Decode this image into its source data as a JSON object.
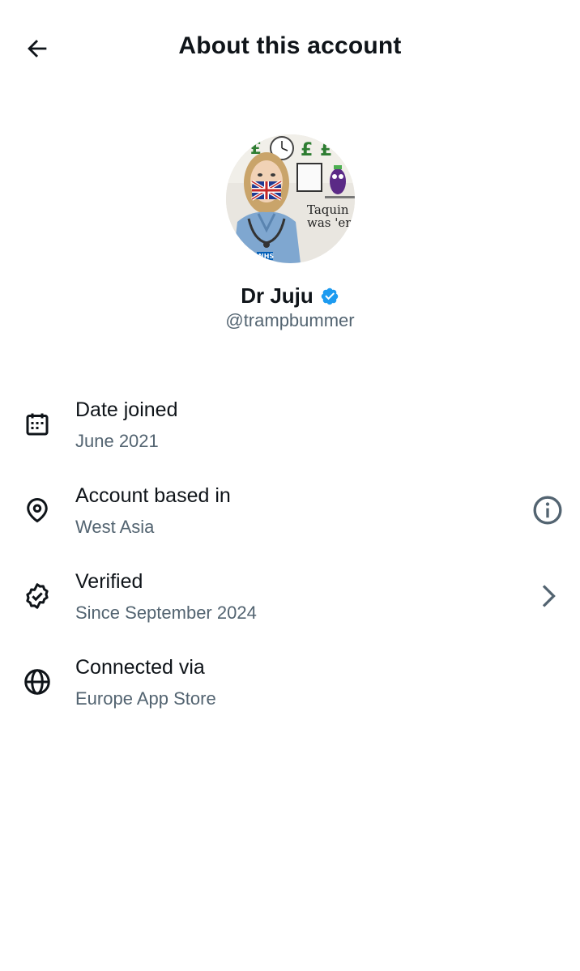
{
  "header": {
    "title": "About this account",
    "back_icon": "arrow-left-icon"
  },
  "profile": {
    "name": "Dr Juju",
    "handle": "@trampbummer",
    "verified": true,
    "badge_color": "#1d9bf0",
    "avatar_text_lines": [
      "Taquin",
      "was 'ere"
    ]
  },
  "details": [
    {
      "icon": "calendar-icon",
      "label": "Date joined",
      "value": "June 2021"
    },
    {
      "icon": "location-pin-icon",
      "label": "Account based in",
      "value": "West Asia",
      "trailing_icon": "info-icon"
    },
    {
      "icon": "verified-badge-icon",
      "label": "Verified",
      "value": "Since September 2024",
      "trailing_icon": "chevron-right-icon"
    },
    {
      "icon": "globe-icon",
      "label": "Connected via",
      "value": "Europe App Store"
    }
  ],
  "colors": {
    "text_primary": "#0f1419",
    "text_secondary": "#536471",
    "accent": "#1d9bf0"
  }
}
